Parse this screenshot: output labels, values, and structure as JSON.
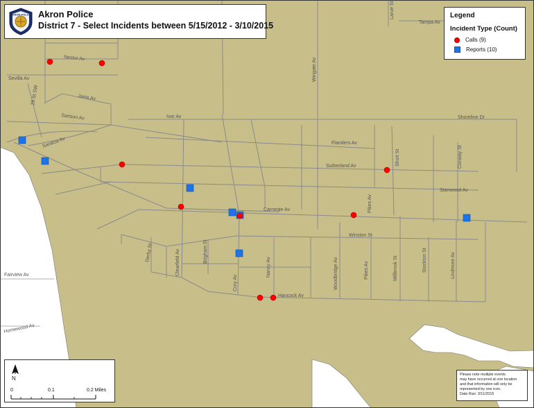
{
  "title": {
    "agency": "Akron Police",
    "subtitle": "District 7 - Select Incidents between 5/15/2012 - 3/10/2015",
    "badge_text": "AKRON POLICE"
  },
  "legend": {
    "title": "Legend",
    "subtitle": "Incident Type (Count)",
    "items": [
      {
        "label": "Calls (9)",
        "symbol": "red-dot",
        "color": "#ff0000"
      },
      {
        "label": "Reports (10)",
        "symbol": "blue-square",
        "color": "#1e73e8"
      }
    ]
  },
  "note": {
    "lines": [
      "Please note multiple events",
      "may have occurred at one location",
      "and that information will only be",
      "represented by one icon.",
      "Date Ran: 3/11/2015"
    ]
  },
  "scale": {
    "north_label": "N",
    "ticks": [
      "0",
      "0.1",
      "0.2 Miles"
    ]
  },
  "colors": {
    "land": "#c8be8a",
    "water_white": "#ffffff",
    "street": "#8a8a8a",
    "calls": "#ff0000",
    "reports": "#1e73e8"
  },
  "streets": [
    {
      "name": "Larue St"
    },
    {
      "name": "Tampa Av"
    },
    {
      "name": "Weiser Av"
    },
    {
      "name": "Nestor Av"
    },
    {
      "name": "Sevilla Av"
    },
    {
      "name": "28 St SW"
    },
    {
      "name": "Janis Av"
    },
    {
      "name": "Sartson Av"
    },
    {
      "name": "Saratoa Av"
    },
    {
      "name": "Ivor Av"
    },
    {
      "name": "Wingate Av"
    },
    {
      "name": "Shoreline Dr"
    },
    {
      "name": "Flanders Av"
    },
    {
      "name": "Sutherland Av"
    },
    {
      "name": "Short St"
    },
    {
      "name": "Conway St"
    },
    {
      "name": "Stanwood Av"
    },
    {
      "name": "Pikes Av"
    },
    {
      "name": "Carnegie Av"
    },
    {
      "name": "Winston St"
    },
    {
      "name": "Derby St"
    },
    {
      "name": "Clearfield Av"
    },
    {
      "name": "Brigham St"
    },
    {
      "name": "Cory Av"
    },
    {
      "name": "Nancy Av"
    },
    {
      "name": "Woodbridge Av"
    },
    {
      "name": "Pikes Av"
    },
    {
      "name": "Millbrook St"
    },
    {
      "name": "Stockton St"
    },
    {
      "name": "Lindmore Av"
    },
    {
      "name": "Hancock Av"
    },
    {
      "name": "Fairview Av"
    },
    {
      "name": "Homewood Av"
    }
  ],
  "incidents": {
    "calls": 9,
    "reports": 10
  }
}
